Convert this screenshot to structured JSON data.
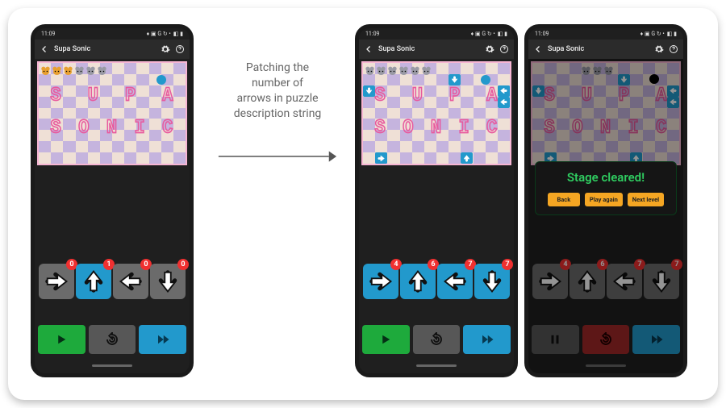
{
  "status": {
    "time": "11:09",
    "icons": "♦ ▣ G ↻ •",
    "batt": "◧ ▮"
  },
  "titlebar": {
    "title": "Supa Sonic"
  },
  "caption_lines": [
    "Patching the",
    "number of",
    "arrows in puzzle",
    "description string"
  ],
  "boardText": {
    "supa": "SUPA",
    "sonic": "SONIC"
  },
  "phones": {
    "before": {
      "mice_colors": [
        "gold",
        "gold",
        "gold",
        "gray",
        "gray",
        "gray"
      ],
      "hole": "blue",
      "placed_arrows": [],
      "tray": [
        {
          "dir": "right",
          "count": 0,
          "blue": false
        },
        {
          "dir": "up",
          "count": 1,
          "blue": true
        },
        {
          "dir": "left",
          "count": 0,
          "blue": false
        },
        {
          "dir": "down",
          "count": 0,
          "blue": false
        }
      ],
      "controls": [
        "play-green",
        "reset-gray",
        "ff-blue"
      ]
    },
    "after": {
      "mice_colors": [
        "gray",
        "gray",
        "gray",
        "gray",
        "gray",
        "gray"
      ],
      "hole": "blue",
      "placed_arrows": [
        {
          "dir": "down",
          "r": 1,
          "c": 7
        },
        {
          "dir": "down",
          "r": 2,
          "c": 0
        },
        {
          "dir": "left",
          "r": 2,
          "c": 11
        },
        {
          "dir": "left",
          "r": 3,
          "c": 11
        },
        {
          "dir": "right",
          "r": 8,
          "c": 1
        },
        {
          "dir": "up",
          "r": 8,
          "c": 8
        }
      ],
      "tray": [
        {
          "dir": "right",
          "count": 4,
          "blue": true
        },
        {
          "dir": "up",
          "count": 6,
          "blue": true
        },
        {
          "dir": "left",
          "count": 7,
          "blue": true
        },
        {
          "dir": "down",
          "count": 7,
          "blue": true
        }
      ],
      "controls": [
        "play-green",
        "reset-gray",
        "ff-blue"
      ]
    },
    "cleared": {
      "mice_colors": [
        "gray",
        "gray",
        "gray"
      ],
      "hole": "black",
      "placed_arrows": [
        {
          "dir": "down",
          "r": 1,
          "c": 7
        },
        {
          "dir": "down",
          "r": 2,
          "c": 0
        },
        {
          "dir": "left",
          "r": 2,
          "c": 11
        },
        {
          "dir": "left",
          "r": 3,
          "c": 11
        },
        {
          "dir": "right",
          "r": 8,
          "c": 1
        },
        {
          "dir": "up",
          "r": 8,
          "c": 8
        }
      ],
      "tray": [
        {
          "dir": "right",
          "count": 4,
          "blue": false
        },
        {
          "dir": "up",
          "count": 6,
          "blue": false
        },
        {
          "dir": "left",
          "count": 7,
          "blue": false
        },
        {
          "dir": "down",
          "count": 7,
          "blue": false
        }
      ],
      "controls": [
        "pause-gray",
        "reset-red",
        "ff-blue"
      ],
      "dialog": {
        "title": "Stage cleared!",
        "buttons": [
          "Back",
          "Play again",
          "Next level"
        ]
      }
    }
  }
}
